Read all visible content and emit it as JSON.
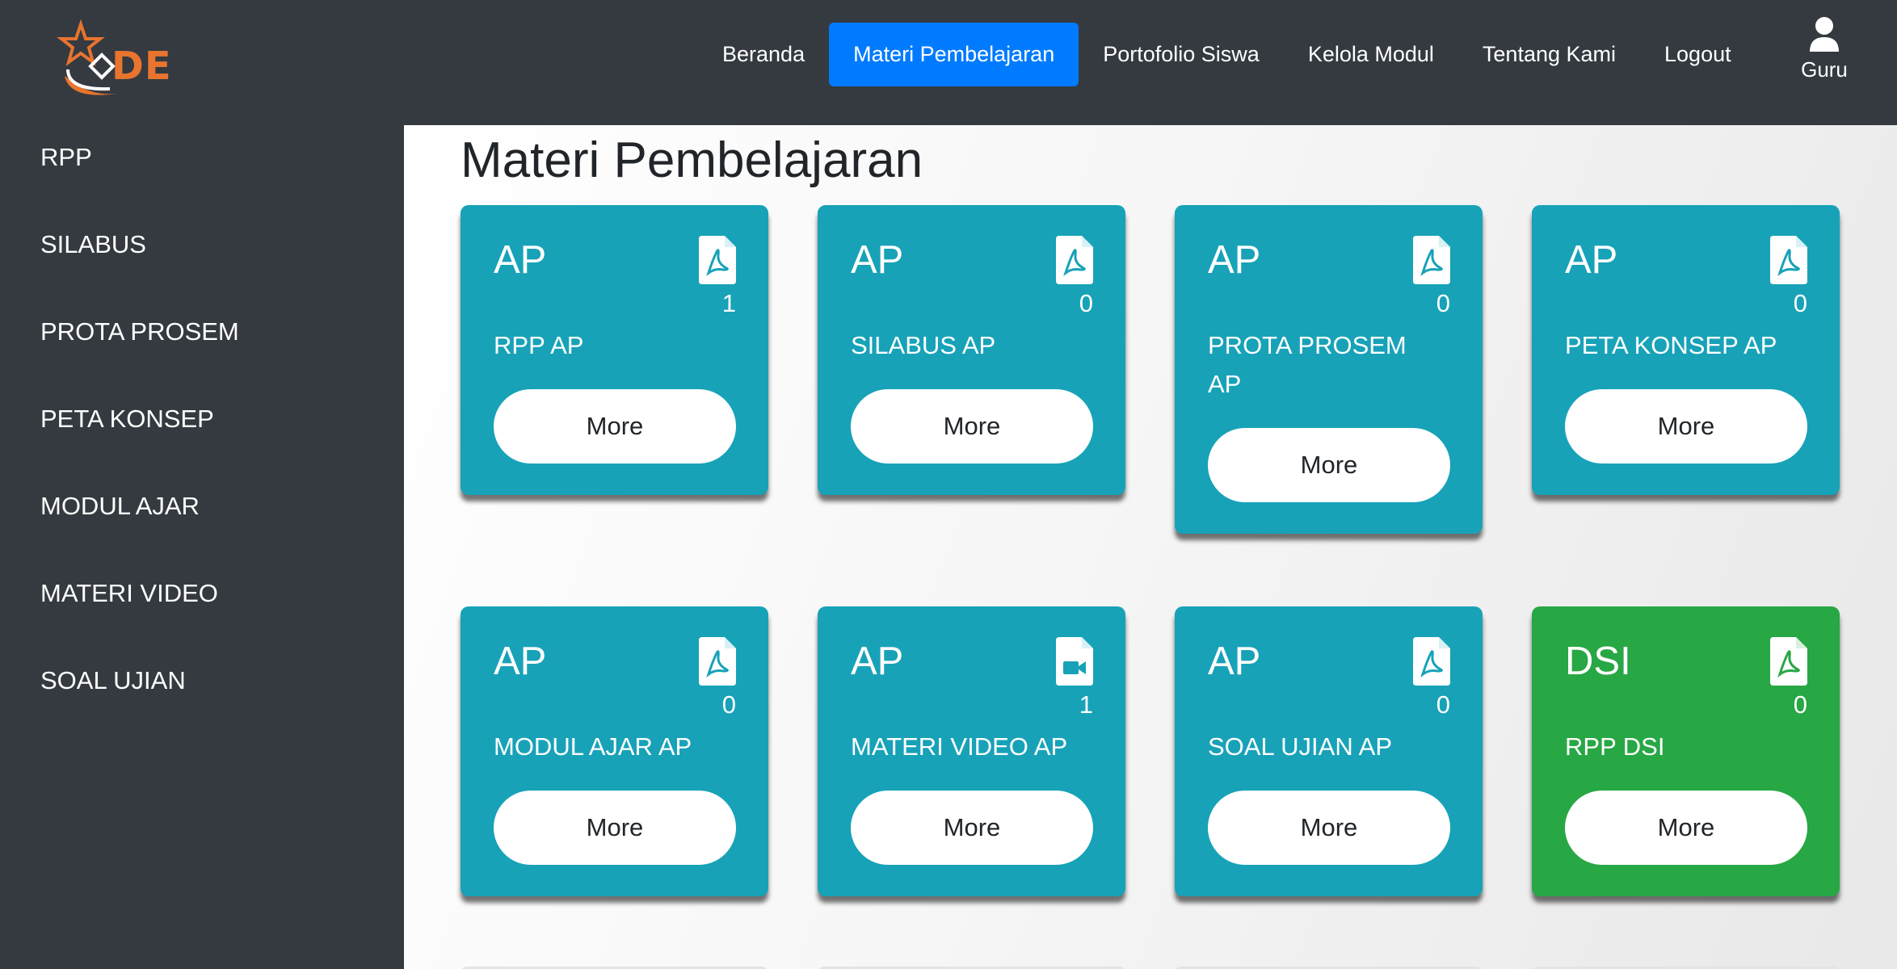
{
  "brand": {
    "logo_text": "DE"
  },
  "nav": {
    "items": [
      {
        "label": "Beranda",
        "active": false
      },
      {
        "label": "Materi Pembelajaran",
        "active": true
      },
      {
        "label": "Portofolio Siswa",
        "active": false
      },
      {
        "label": "Kelola Modul",
        "active": false
      },
      {
        "label": "Tentang Kami",
        "active": false
      },
      {
        "label": "Logout",
        "active": false
      }
    ],
    "user": {
      "label": "Guru",
      "icon": "user-icon"
    }
  },
  "sidebar": {
    "items": [
      {
        "label": "RPP"
      },
      {
        "label": "SILABUS"
      },
      {
        "label": "PROTA PROSEM"
      },
      {
        "label": "PETA KONSEP"
      },
      {
        "label": "MODUL AJAR"
      },
      {
        "label": "MATERI VIDEO"
      },
      {
        "label": "SOAL UJIAN"
      }
    ]
  },
  "main": {
    "title": "Materi Pembelajaran",
    "cards": [
      {
        "code": "AP",
        "count": "1",
        "label": "RPP AP",
        "button": "More",
        "icon": "pdf-file-icon",
        "color": "#17a2b8"
      },
      {
        "code": "AP",
        "count": "0",
        "label": "SILABUS AP",
        "button": "More",
        "icon": "pdf-file-icon",
        "color": "#17a2b8"
      },
      {
        "code": "AP",
        "count": "0",
        "label": "PROTA PROSEM AP",
        "button": "More",
        "icon": "pdf-file-icon",
        "color": "#17a2b8"
      },
      {
        "code": "AP",
        "count": "0",
        "label": "PETA KONSEP AP",
        "button": "More",
        "icon": "pdf-file-icon",
        "color": "#17a2b8"
      },
      {
        "code": "AP",
        "count": "0",
        "label": "MODUL AJAR AP",
        "button": "More",
        "icon": "pdf-file-icon",
        "color": "#17a2b8"
      },
      {
        "code": "AP",
        "count": "1",
        "label": "MATERI VIDEO AP",
        "button": "More",
        "icon": "video-file-icon",
        "color": "#17a2b8"
      },
      {
        "code": "AP",
        "count": "0",
        "label": "SOAL UJIAN AP",
        "button": "More",
        "icon": "pdf-file-icon",
        "color": "#17a2b8"
      },
      {
        "code": "DSI",
        "count": "0",
        "label": "RPP DSI",
        "button": "More",
        "icon": "pdf-file-icon",
        "color": "#28a745"
      }
    ]
  },
  "colors": {
    "navbar": "#343a40",
    "active_nav": "#007bff",
    "card_teal": "#17a2b8",
    "card_green": "#28a745",
    "logo_accent": "#e8742e"
  }
}
